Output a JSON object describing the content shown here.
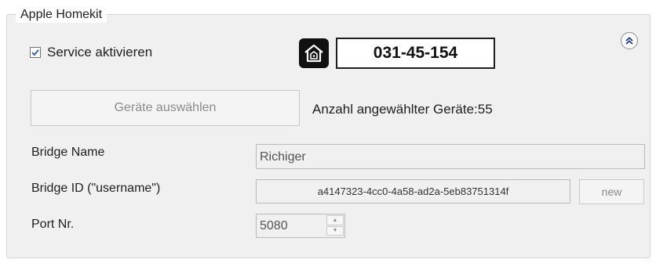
{
  "group": {
    "title": "Apple Homekit"
  },
  "service": {
    "checkbox_label": "Service aktivieren",
    "checked": true
  },
  "pairing": {
    "icon": "homekit-house-icon",
    "code": "031-45-154"
  },
  "collapse": {
    "icon": "double-chevron-up-icon"
  },
  "devices": {
    "select_button_label": "Geräte auswählen",
    "count_label": "Anzahl angewählter Geräte:55"
  },
  "bridge": {
    "name_label": "Bridge Name",
    "name_value": "Richiger",
    "id_label": "Bridge ID (\"username\")",
    "id_value": "a4147323-4cc0-4a58-ad2a-5eb83751314f",
    "new_button_label": "new",
    "port_label": "Port Nr.",
    "port_value": "5080"
  },
  "colors": {
    "panel_bg": "#f0f0f0",
    "check_blue": "#3a64b8"
  }
}
